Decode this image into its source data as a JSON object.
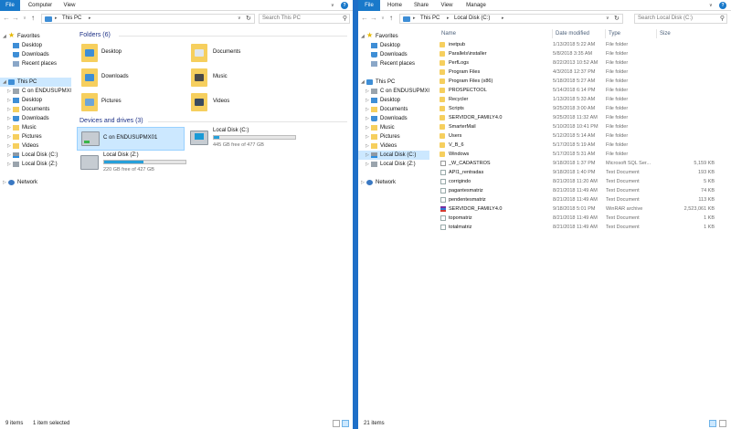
{
  "left": {
    "ribbon_tabs": [
      "File",
      "Computer",
      "View"
    ],
    "help": "?",
    "address": [
      "This PC"
    ],
    "search_placeholder": "Search This PC",
    "nav": {
      "favorites": "Favorites",
      "fav_items": [
        "Desktop",
        "Downloads",
        "Recent places"
      ],
      "this_pc": "This PC",
      "pc_items": [
        "C on ENDUSUPMX0",
        "Desktop",
        "Documents",
        "Downloads",
        "Music",
        "Pictures",
        "Videos",
        "Local Disk (C:)",
        "Local Disk (Z:)"
      ],
      "network": "Network"
    },
    "folders_header": "Folders (6)",
    "folders": [
      "Desktop",
      "Documents",
      "Downloads",
      "Music",
      "Pictures",
      "Videos"
    ],
    "devices_header": "Devices and drives (3)",
    "drives": [
      {
        "name": "C on ENDUSUPMX01",
        "free": "",
        "used": null
      },
      {
        "name": "Local Disk (C:)",
        "free": "445 GB free of 477 GB",
        "used": 0.067
      },
      {
        "name": "Local Disk (Z:)",
        "free": "220 GB free of 427 GB",
        "used": 0.485
      }
    ],
    "status_items": "9 items",
    "status_selected": "1 item selected"
  },
  "right": {
    "ribbon_tabs": [
      "File",
      "Home",
      "Share",
      "View",
      "Manage"
    ],
    "help": "?",
    "address": [
      "This PC",
      "Local Disk (C:)"
    ],
    "search_placeholder": "Search Local Disk (C:)",
    "nav": {
      "favorites": "Favorites",
      "fav_items": [
        "Desktop",
        "Downloads",
        "Recent places"
      ],
      "this_pc": "This PC",
      "pc_items": [
        "C on ENDUSUPMX0",
        "Desktop",
        "Documents",
        "Downloads",
        "Music",
        "Pictures",
        "Videos",
        "Local Disk (C:)",
        "Local Disk (Z:)"
      ],
      "network": "Network"
    },
    "columns": [
      "Name",
      "Date modified",
      "Type",
      "Size"
    ],
    "files": [
      {
        "name": "inetpub",
        "date": "1/13/2018 5:22 AM",
        "type": "File folder",
        "size": "",
        "icon": "folder"
      },
      {
        "name": "Parallels\\installer",
        "date": "5/8/2018 3:35 AM",
        "type": "File folder",
        "size": "",
        "icon": "folder"
      },
      {
        "name": "PerfLogs",
        "date": "8/22/2013 10:52 AM",
        "type": "File folder",
        "size": "",
        "icon": "folder"
      },
      {
        "name": "Program Files",
        "date": "4/3/2018 12:37 PM",
        "type": "File folder",
        "size": "",
        "icon": "folder"
      },
      {
        "name": "Program Files (x86)",
        "date": "5/18/2018 5:27 AM",
        "type": "File folder",
        "size": "",
        "icon": "folder"
      },
      {
        "name": "PROSPECTOOL",
        "date": "5/14/2018 6:14 PM",
        "type": "File folder",
        "size": "",
        "icon": "folder"
      },
      {
        "name": "Recycler",
        "date": "1/13/2018 5:33 AM",
        "type": "File folder",
        "size": "",
        "icon": "folder"
      },
      {
        "name": "Scripts",
        "date": "9/25/2018 3:00 AM",
        "type": "File folder",
        "size": "",
        "icon": "folder"
      },
      {
        "name": "SERVIDOR_FAMILY4.0",
        "date": "9/25/2018 11:32 AM",
        "type": "File folder",
        "size": "",
        "icon": "folder"
      },
      {
        "name": "SmarterMail",
        "date": "5/10/2018 10:41 PM",
        "type": "File folder",
        "size": "",
        "icon": "folder"
      },
      {
        "name": "Users",
        "date": "5/12/2018 5:14 AM",
        "type": "File folder",
        "size": "",
        "icon": "folder"
      },
      {
        "name": "V_B_6",
        "date": "5/17/2018 5:19 AM",
        "type": "File folder",
        "size": "",
        "icon": "folder"
      },
      {
        "name": "Windows",
        "date": "5/17/2018 5:31 AM",
        "type": "File folder",
        "size": "",
        "icon": "folder"
      },
      {
        "name": "_W_CADASTROS",
        "date": "9/18/2018 1:37 PM",
        "type": "Microsoft SQL Ser...",
        "size": "5,159 KB",
        "icon": "sql"
      },
      {
        "name": "API1_rentradas",
        "date": "9/18/2018 1:40 PM",
        "type": "Text Document",
        "size": "193 KB",
        "icon": "txt"
      },
      {
        "name": "corrigindo",
        "date": "8/21/2018 11:20 AM",
        "type": "Text Document",
        "size": "5 KB",
        "icon": "txt"
      },
      {
        "name": "pagantesmatriz",
        "date": "8/21/2018 11:49 AM",
        "type": "Text Document",
        "size": "74 KB",
        "icon": "txt"
      },
      {
        "name": "pendentesmatriz",
        "date": "8/21/2018 11:49 AM",
        "type": "Text Document",
        "size": "113 KB",
        "icon": "txt"
      },
      {
        "name": "SERVIDOR_FAMILY4.0",
        "date": "9/18/2018 5:01 PM",
        "type": "WinRAR archive",
        "size": "2,523,061 KB",
        "icon": "rar"
      },
      {
        "name": "topomatriz",
        "date": "8/21/2018 11:49 AM",
        "type": "Text Document",
        "size": "1 KB",
        "icon": "txt"
      },
      {
        "name": "totalmatriz",
        "date": "8/21/2018 11:49 AM",
        "type": "Text Document",
        "size": "1 KB",
        "icon": "txt"
      }
    ],
    "status_items": "21 items"
  },
  "colors": {
    "accent": "#1979ca",
    "selection": "#cce8ff",
    "desktop": "#1e5fa8",
    "folder": "#f6cf5e",
    "drive_bar": "#26a0da"
  }
}
